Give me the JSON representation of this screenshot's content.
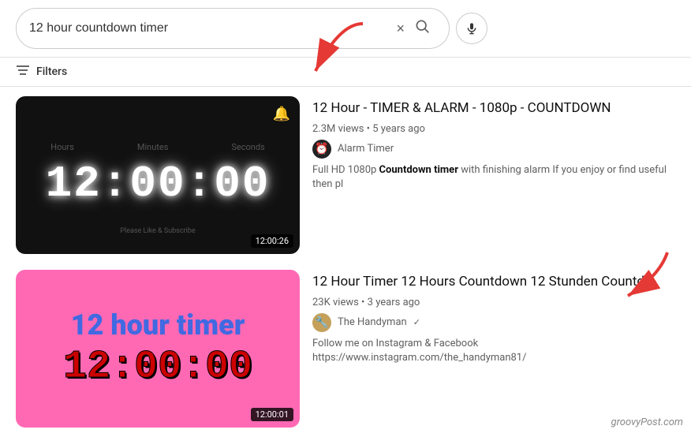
{
  "search": {
    "query": "12 hour countdown timer",
    "clear_label": "×",
    "search_icon_label": "🔍",
    "mic_icon_label": "🎤"
  },
  "filters": {
    "label": "Filters",
    "icon_label": "⚙"
  },
  "results": [
    {
      "id": "result-1",
      "title": "12 Hour - TIMER & ALARM - 1080p - COUNTDOWN",
      "stats": "2.3M views • 5 years ago",
      "channel_name": "Alarm Timer",
      "channel_icon": "⏰",
      "description_pre": "Full HD 1080p ",
      "description_bold": "Countdown timer",
      "description_post": " with finishing alarm If you enjoy or find useful then pl",
      "thumbnail_type": "dark",
      "duration": "12:00:26",
      "thumb_hours": "Hours",
      "thumb_minutes": "Minutes",
      "thumb_seconds": "Seconds",
      "thumb_time": "12:00:00",
      "thumb_subscribe": "Please Like & Subscribe"
    },
    {
      "id": "result-2",
      "title": "12 Hour Timer 12 Hours Countdown 12 Stunden Countdo",
      "stats": "23K views • 3 years ago",
      "channel_name": "The Handyman",
      "channel_icon": "🔨",
      "description": "Follow me on Instagram & Facebook https://www.instagram.com/the_handyman81/",
      "thumbnail_type": "pink",
      "duration": "12:00:01",
      "thumb_top": "12 hour timer",
      "thumb_time": "12:00:00"
    }
  ],
  "watermark": "groovyPost.com"
}
